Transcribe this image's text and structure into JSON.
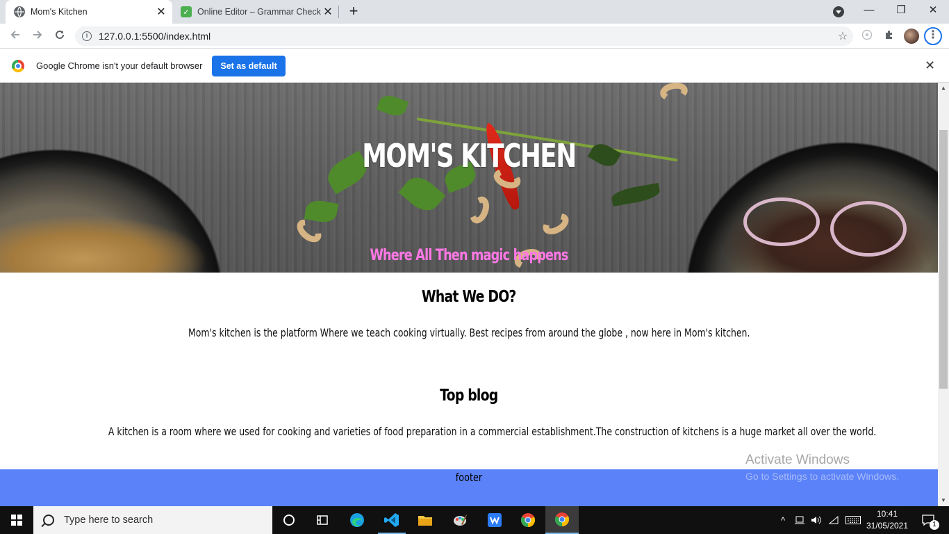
{
  "browser": {
    "tabs": [
      {
        "title": "Mom's Kitchen",
        "active": true,
        "favicon": "globe-icon"
      },
      {
        "title": "Online Editor – Grammar Checke",
        "active": false,
        "favicon": "check-icon"
      }
    ],
    "new_tab_symbol": "+",
    "url": "127.0.0.1:5500/index.html",
    "window_controls": {
      "minimize": "—",
      "restore": "❐",
      "close": "✕"
    },
    "toolbar_icons": [
      "back-arrow-icon",
      "forward-arrow-icon",
      "reload-icon",
      "bookmark-star-icon",
      "extension-icon",
      "puzzle-icon",
      "profile-avatar",
      "menu-icon"
    ]
  },
  "infobar": {
    "message": "Google Chrome isn't your default browser",
    "button": "Set as default",
    "close": "✕"
  },
  "page": {
    "hero_title": "MOM'S KITCHEN",
    "hero_subtitle": "Where All Then magic happens",
    "sections": [
      {
        "heading": "What We DO?",
        "text": "Mom's kitchen is the platform Where we teach cooking virtually. Best recipes from around the globe , now here in Mom's kitchen."
      },
      {
        "heading": "Top blog",
        "text": "A kitchen is a room where we used for cooking and varieties of food preparation in a commercial establishment.The construction of kitchens is a huge market all over the world."
      }
    ],
    "footer": "footer"
  },
  "watermark": {
    "line1": "Activate Windows",
    "line2": "Go to Settings to activate Windows."
  },
  "taskbar": {
    "search_placeholder": "Type here to search",
    "time": "10:41",
    "date": "31/05/2021",
    "notification_count": "1",
    "apps": [
      "cortana-icon",
      "task-view-icon",
      "edge-icon",
      "vscode-icon",
      "file-explorer-icon",
      "paint-icon",
      "wps-icon",
      "chrome-icon",
      "chrome-active-icon"
    ]
  },
  "colors": {
    "accent_blue": "#1a73e8",
    "subtitle_pink": "#ff78e5",
    "footer_blue": "#5b82f8"
  }
}
